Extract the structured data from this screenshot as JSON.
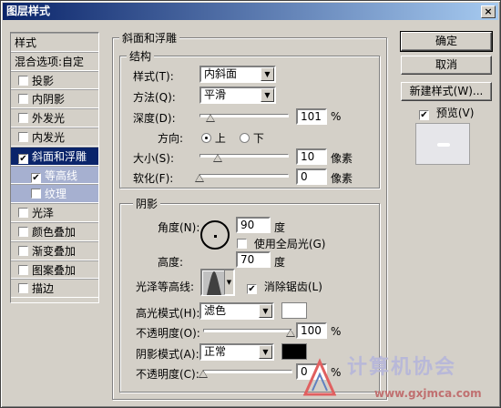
{
  "window": {
    "title": "图层样式",
    "close": "×"
  },
  "left": {
    "header": "样式",
    "blend": "混合选项:自定",
    "items": [
      {
        "label": "投影",
        "checked": false
      },
      {
        "label": "内阴影",
        "checked": false
      },
      {
        "label": "外发光",
        "checked": false
      },
      {
        "label": "内发光",
        "checked": false
      },
      {
        "label": "斜面和浮雕",
        "checked": true
      },
      {
        "label": "等高线",
        "checked": true
      },
      {
        "label": "纹理",
        "checked": false
      },
      {
        "label": "光泽",
        "checked": false
      },
      {
        "label": "颜色叠加",
        "checked": false
      },
      {
        "label": "渐变叠加",
        "checked": false
      },
      {
        "label": "图案叠加",
        "checked": false
      },
      {
        "label": "描边",
        "checked": false
      }
    ]
  },
  "bevel": {
    "section_title": "斜面和浮雕",
    "structure_title": "结构",
    "style_label": "样式(T):",
    "style_value": "内斜面",
    "method_label": "方法(Q):",
    "method_value": "平滑",
    "depth_label": "深度(D):",
    "depth_value": "101",
    "depth_unit": "%",
    "direction_label": "方向:",
    "dir_up": "上",
    "dir_down": "下",
    "size_label": "大小(S):",
    "size_value": "10",
    "size_unit": "像素",
    "soften_label": "软化(F):",
    "soften_value": "0",
    "soften_unit": "像素"
  },
  "shading": {
    "title": "阴影",
    "angle_label": "角度(N):",
    "angle_value": "90",
    "angle_unit": "度",
    "global_light": "使用全局光(G)",
    "altitude_label": "高度:",
    "altitude_value": "70",
    "altitude_unit": "度",
    "gloss_label": "光泽等高线:",
    "antialias": "消除锯齿(L)",
    "highlight_label": "高光模式(H):",
    "highlight_value": "滤色",
    "highlight_color": "#ffffff",
    "hl_opacity_label": "不透明度(O):",
    "hl_opacity_value": "100",
    "hl_opacity_unit": "%",
    "shadow_label": "阴影模式(A):",
    "shadow_value": "正常",
    "shadow_color": "#000000",
    "sh_opacity_label": "不透明度(C):",
    "sh_opacity_value": "0",
    "sh_opacity_unit": "%"
  },
  "buttons": {
    "ok": "确定",
    "cancel": "取消",
    "new_style": "新建样式(W)...",
    "preview": "预览(V)"
  },
  "watermark": {
    "text": "计算机协会",
    "url": "www.gxjmca.com"
  }
}
